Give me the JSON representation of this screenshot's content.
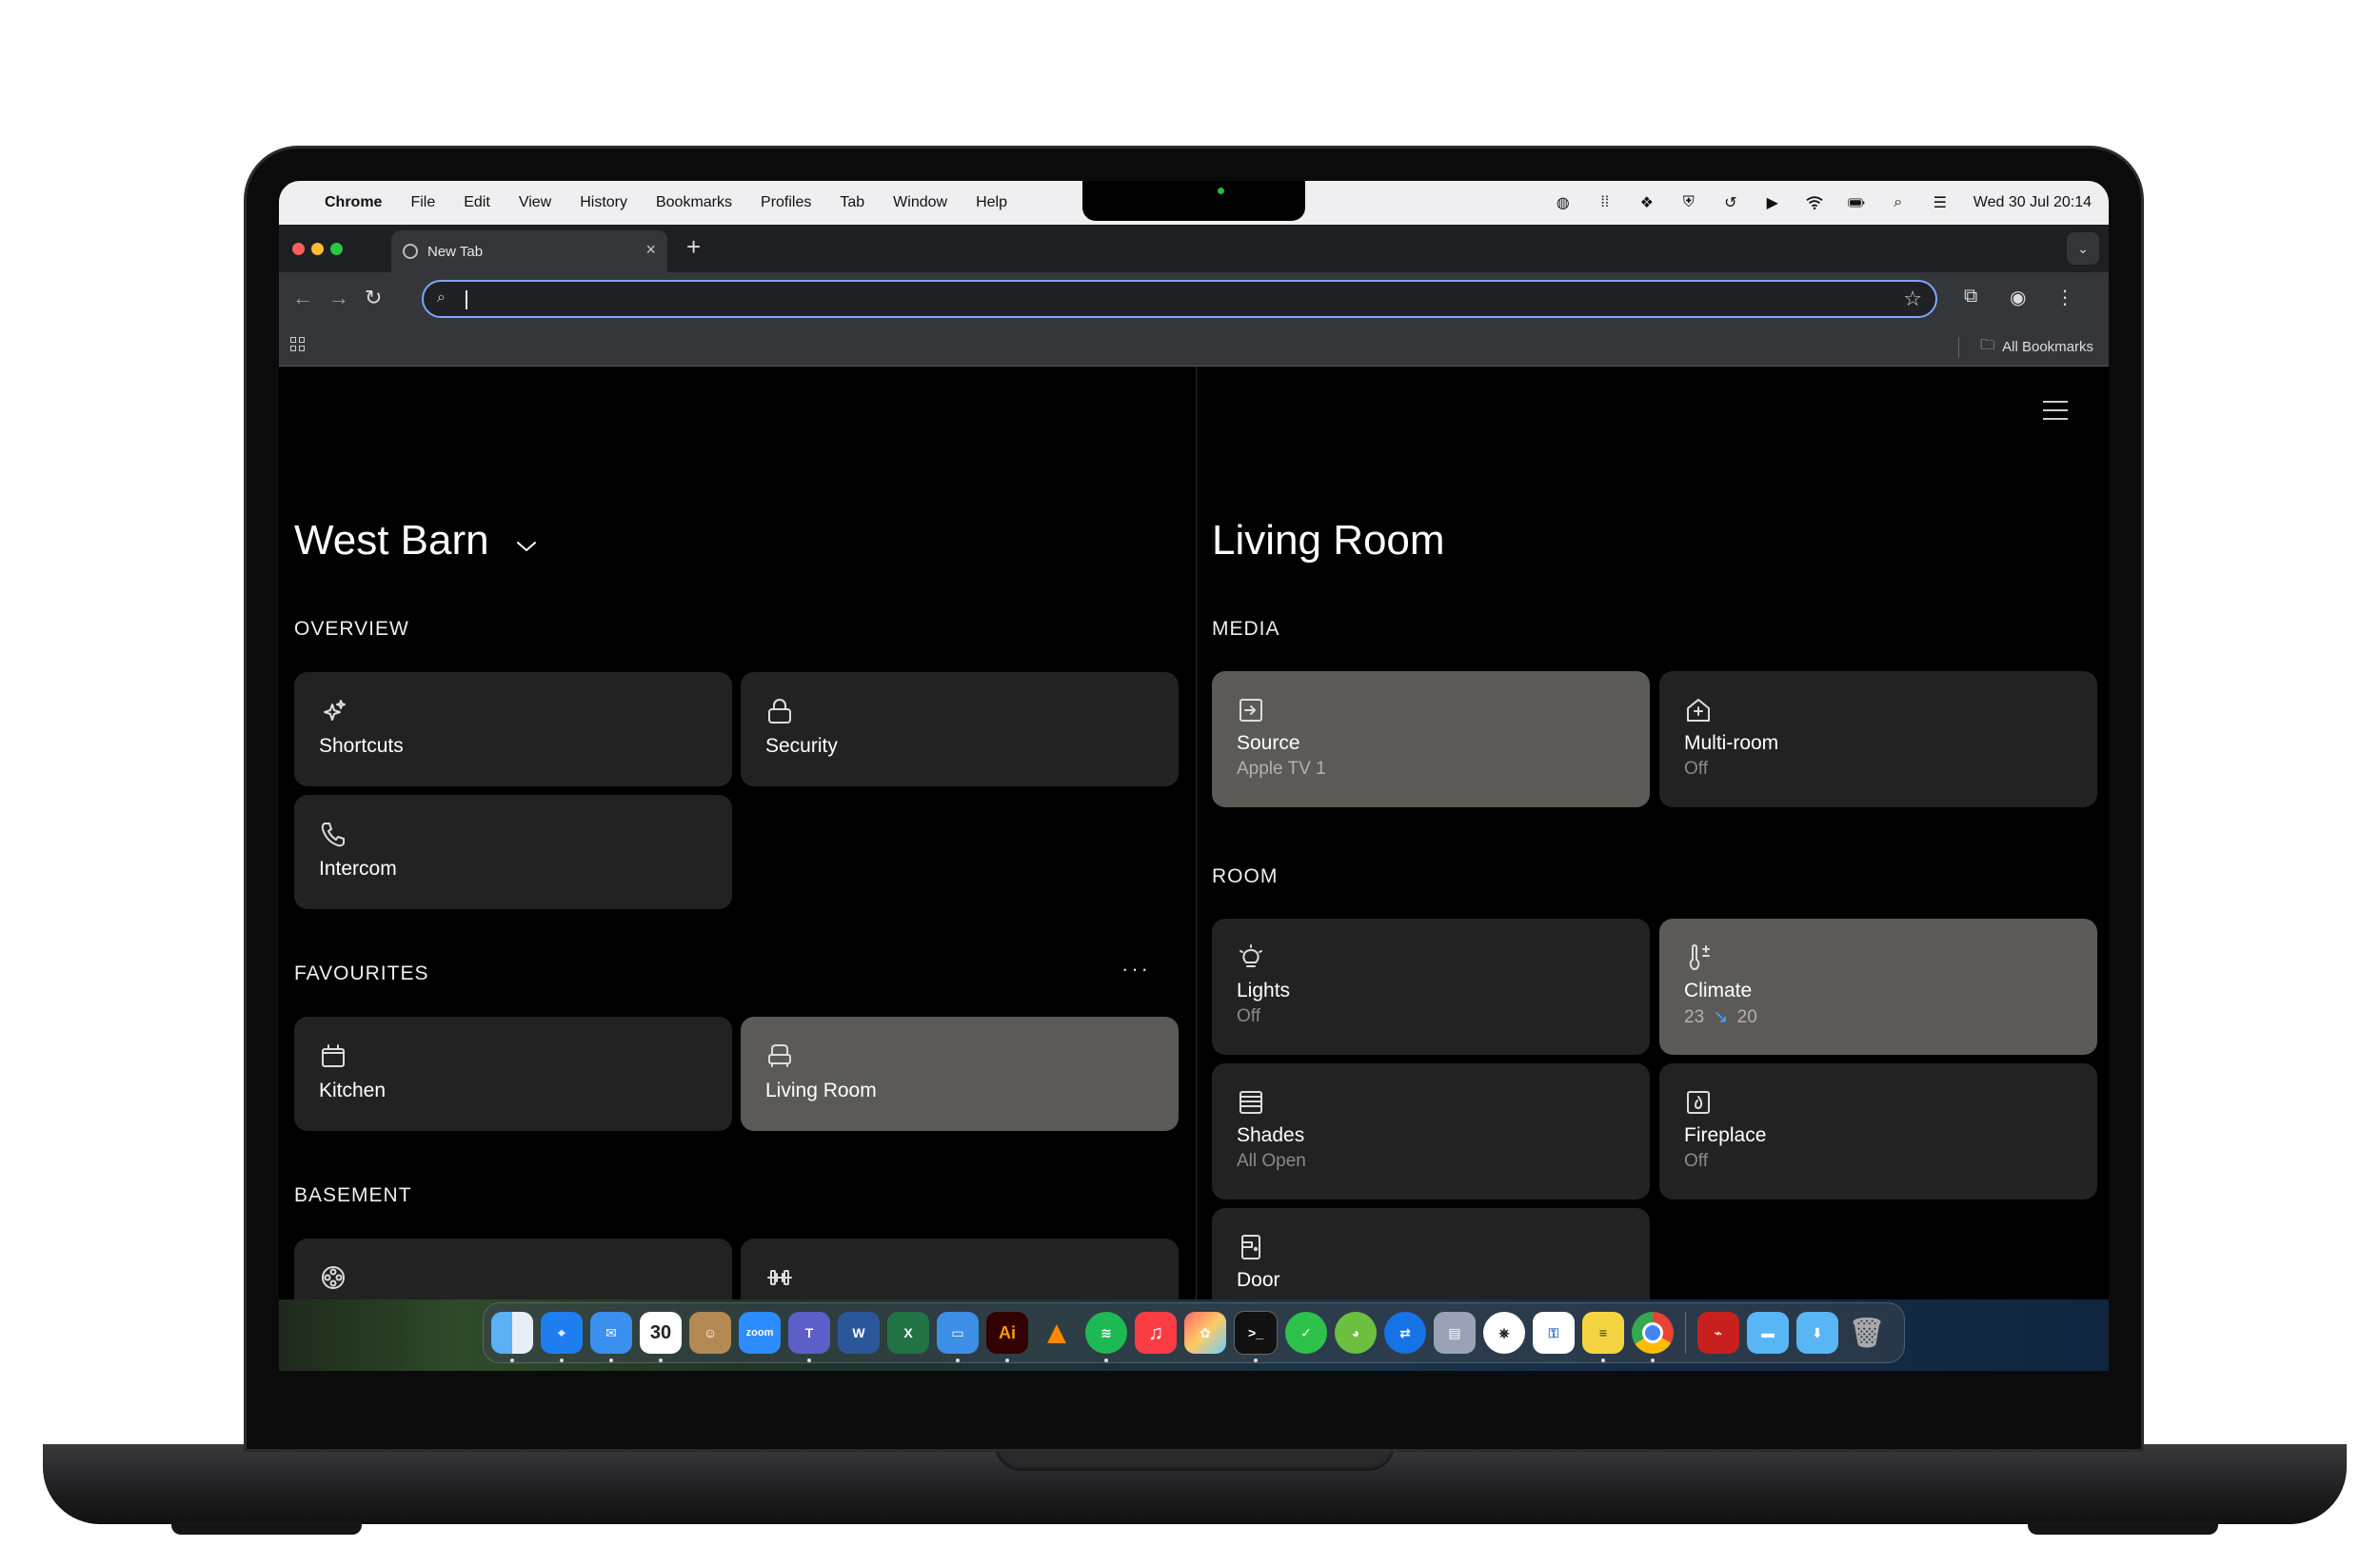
{
  "menubar": {
    "app": "Chrome",
    "items": [
      "File",
      "Edit",
      "View",
      "History",
      "Bookmarks",
      "Profiles",
      "Tab",
      "Window",
      "Help"
    ],
    "clock": "Wed 30 Jul  20:14"
  },
  "browser": {
    "tab_title": "New Tab",
    "all_bookmarks": "All Bookmarks"
  },
  "left": {
    "title": "West Barn",
    "overview": {
      "heading": "OVERVIEW",
      "tiles": [
        {
          "label": "Shortcuts",
          "icon": "sparkles-icon"
        },
        {
          "label": "Security",
          "icon": "lock-icon"
        },
        {
          "label": "Intercom",
          "icon": "phone-icon"
        }
      ]
    },
    "favourites": {
      "heading": "FAVOURITES",
      "more": "···",
      "tiles": [
        {
          "label": "Kitchen",
          "icon": "cabinet-icon"
        },
        {
          "label": "Living Room",
          "icon": "armchair-icon",
          "active": true
        }
      ]
    },
    "basement": {
      "heading": "BASEMENT"
    }
  },
  "right": {
    "title": "Living Room",
    "media": {
      "heading": "MEDIA",
      "tiles": [
        {
          "label": "Source",
          "sub": "Apple TV 1",
          "icon": "input-icon",
          "active": true
        },
        {
          "label": "Multi-room",
          "sub": "Off",
          "icon": "house-plus-icon"
        }
      ]
    },
    "room": {
      "heading": "ROOM",
      "tiles": [
        {
          "label": "Lights",
          "sub": "Off",
          "icon": "bulb-icon"
        },
        {
          "label": "Climate",
          "sub_from": "23",
          "sub_arrow": "↘",
          "sub_to": "20",
          "icon": "thermometer-icon",
          "active": true
        },
        {
          "label": "Shades",
          "sub": "All Open",
          "icon": "shade-icon"
        },
        {
          "label": "Fireplace",
          "sub": "Off",
          "icon": "fire-icon"
        },
        {
          "label": "Door",
          "icon": "door-icon"
        }
      ]
    }
  },
  "dock": {
    "calendar_day": "30",
    "zoom_label": "zoom",
    "illustrator_label": "Ai"
  },
  "colors": {
    "tile": "#222222",
    "tile_active": "#5b5a57",
    "climate_arrow": "#4aa3ff",
    "omnibox_focus": "#7aa7ff"
  }
}
